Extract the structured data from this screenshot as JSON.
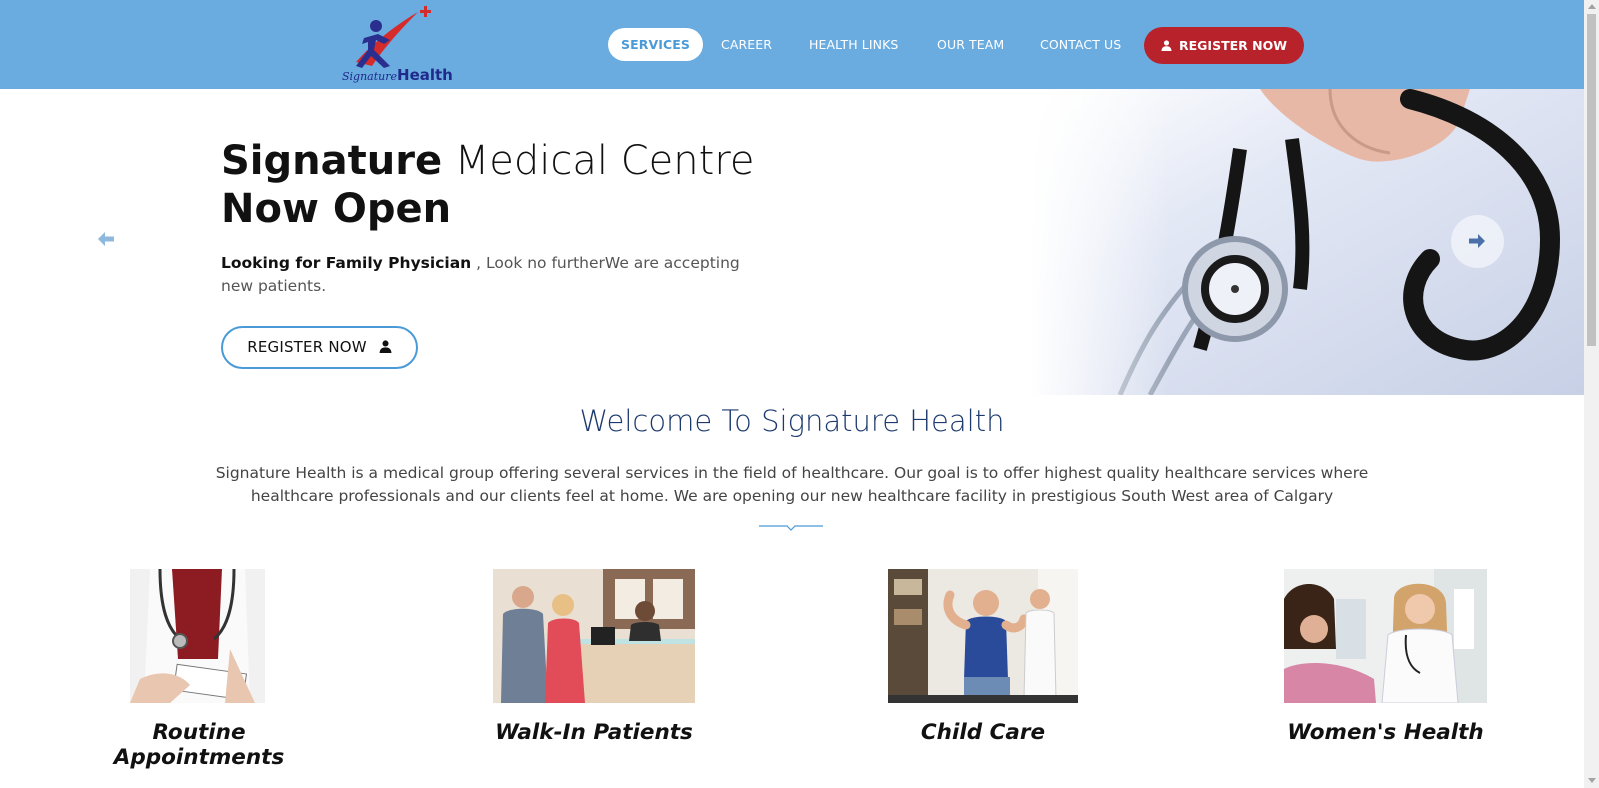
{
  "header": {
    "logo": {
      "script": "Signature",
      "bold": "Health"
    },
    "nav": [
      {
        "label": "SERVICES",
        "active": true
      },
      {
        "label": "CAREER"
      },
      {
        "label": "HEALTH LINKS"
      },
      {
        "label": "OUR TEAM"
      },
      {
        "label": "CONTACT US"
      }
    ],
    "register_label": "REGISTER NOW"
  },
  "hero": {
    "title_bold_1": "Signature",
    "title_light": " Medical Centre",
    "title_bold_2": "Now Open",
    "sub_bold": "Looking for Family Physician",
    "sub_rest": " , Look no furtherWe are accepting new patients.",
    "button_label": "REGISTER NOW"
  },
  "welcome": {
    "title": "Welcome To Signature Health",
    "text": "Signature Health is a medical group offering several services in the field of healthcare. Our goal is to offer highest quality healthcare services where healthcare professionals and our clients feel at home. We are opening our new healthcare facility in prestigious South West area of Calgary"
  },
  "services": [
    {
      "label": "Routine Appointments"
    },
    {
      "label": "Walk-In Patients"
    },
    {
      "label": "Child Care"
    },
    {
      "label": "Women's Health"
    }
  ],
  "colors": {
    "header_bg": "#6aace0",
    "accent_blue": "#4b9ad8",
    "register_red": "#b8222a",
    "welcome_title": "#1d3a6e"
  }
}
